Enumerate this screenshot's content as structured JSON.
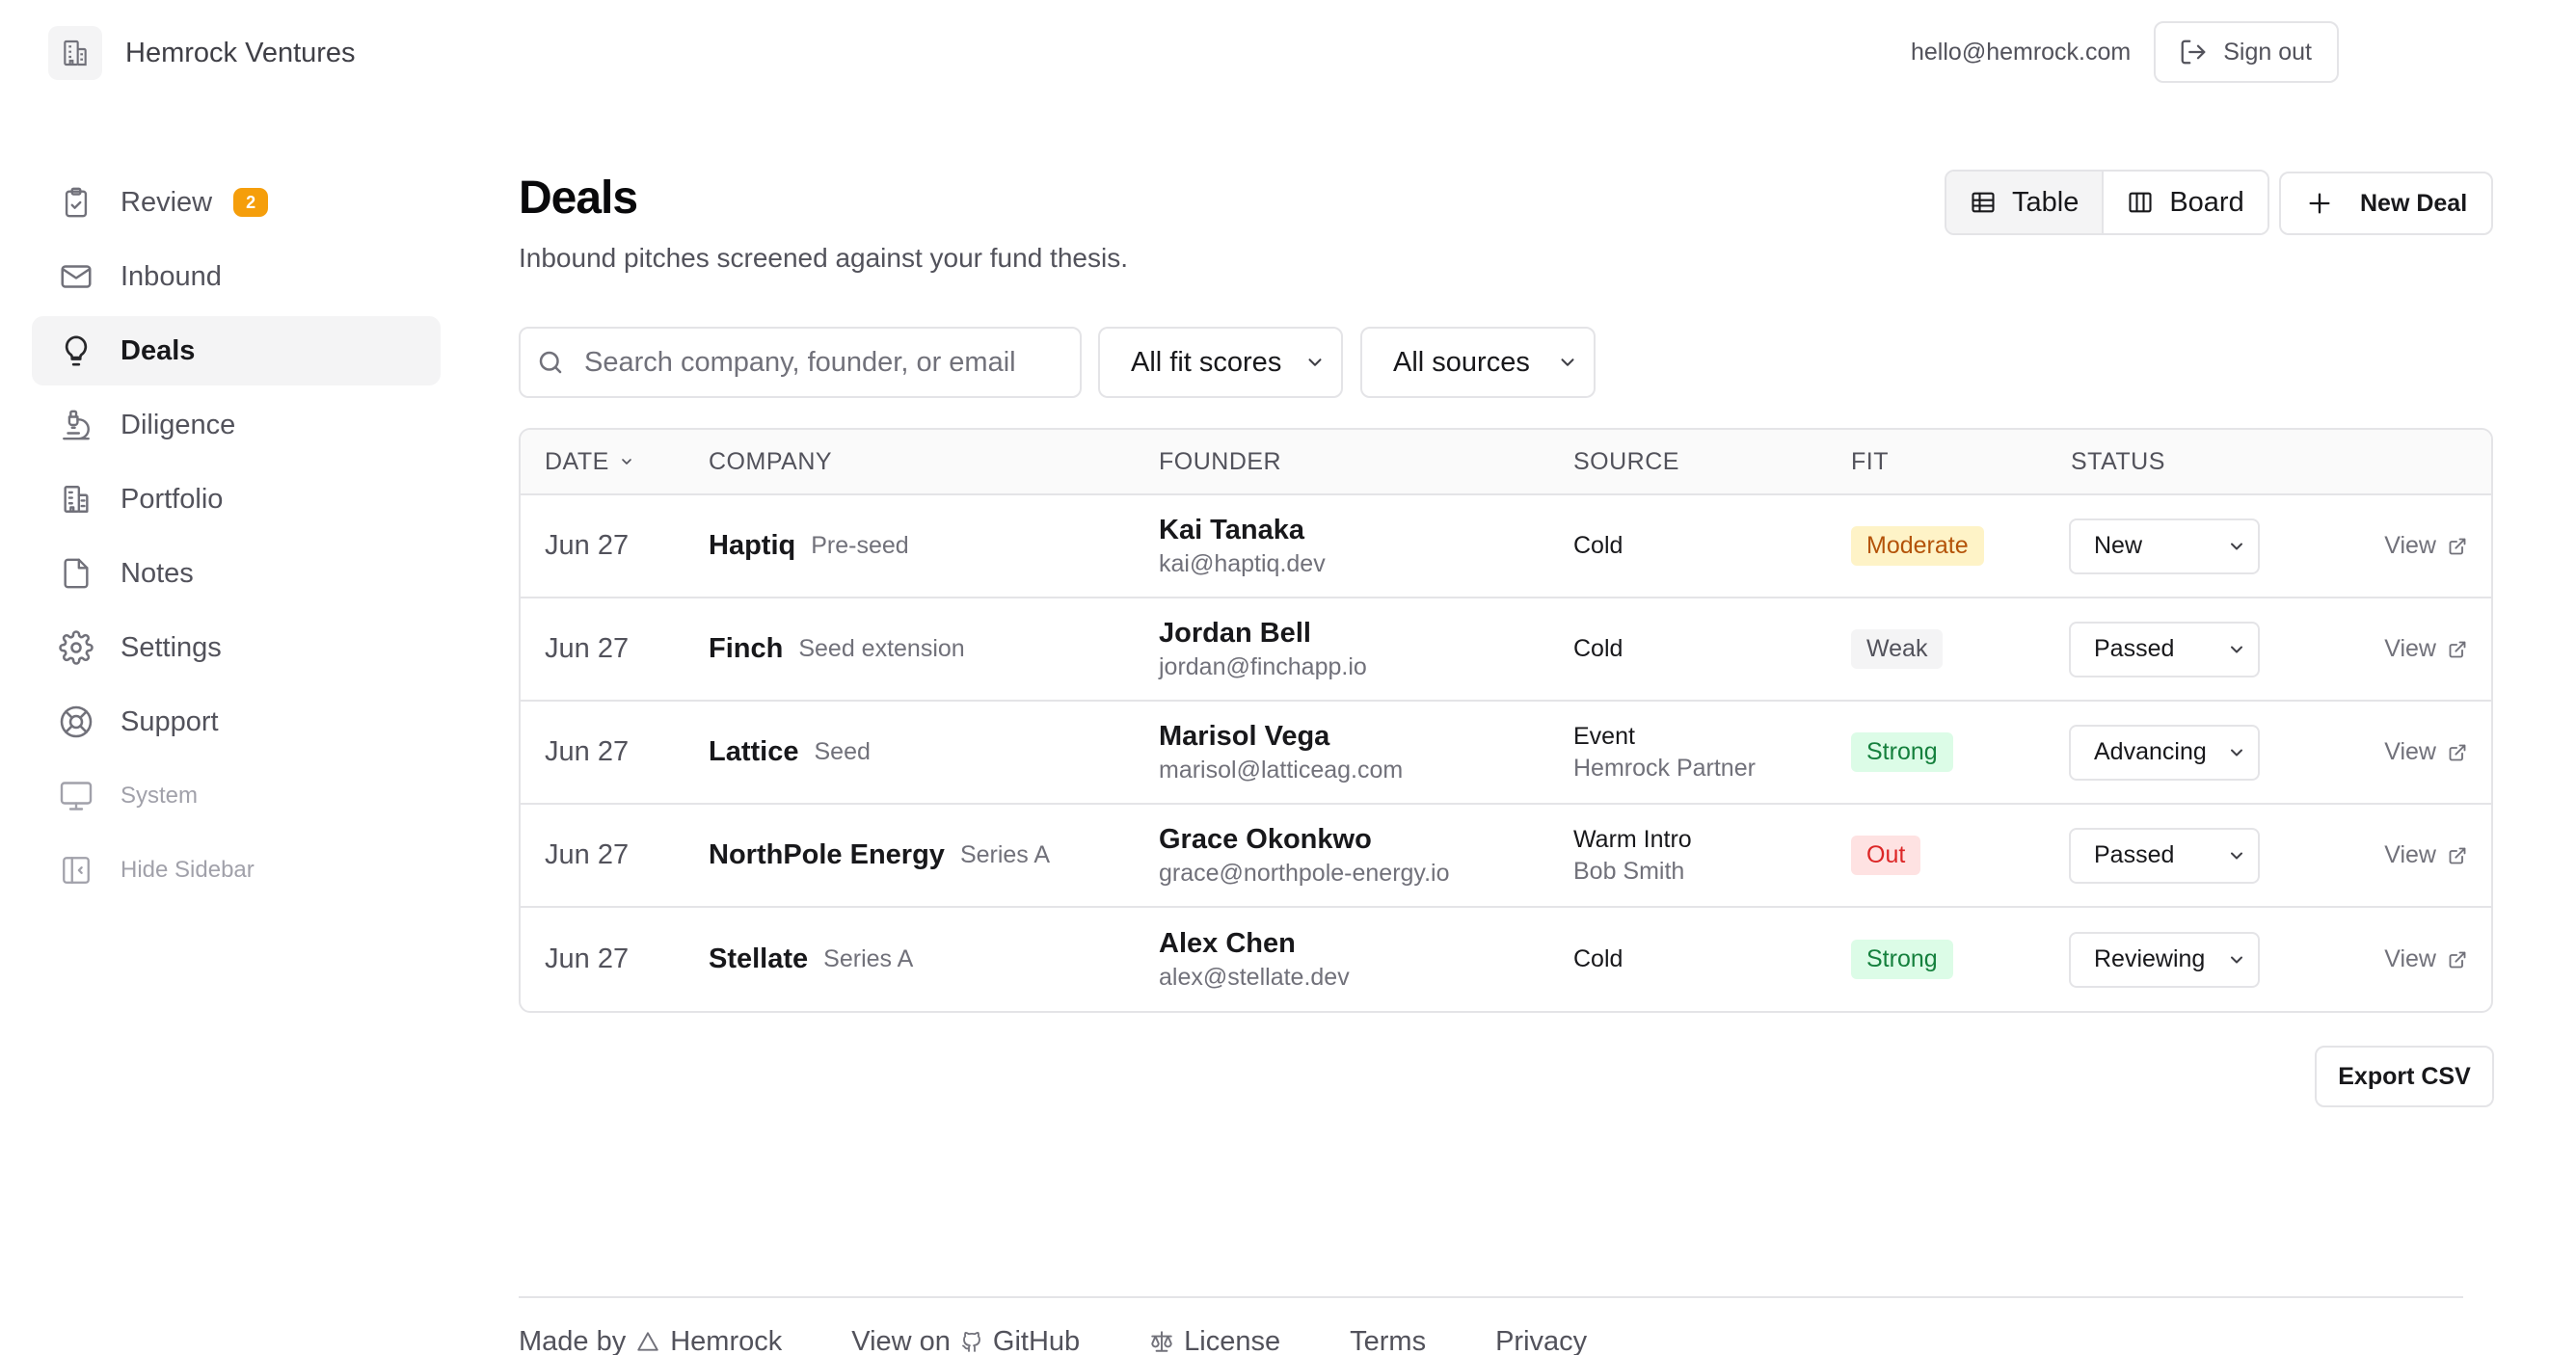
{
  "brand": {
    "name": "Hemrock Ventures",
    "logo_icon": "building-icon"
  },
  "account": {
    "email": "hello@hemrock.com",
    "sign_out_label": "Sign out"
  },
  "sidebar": {
    "items": [
      {
        "label": "Review",
        "icon": "clipboard-check-icon",
        "badge": "2"
      },
      {
        "label": "Inbound",
        "icon": "mail-icon"
      },
      {
        "label": "Deals",
        "icon": "lightbulb-icon",
        "active": true
      },
      {
        "label": "Diligence",
        "icon": "microscope-icon"
      },
      {
        "label": "Portfolio",
        "icon": "building-icon"
      },
      {
        "label": "Notes",
        "icon": "file-icon"
      },
      {
        "label": "Settings",
        "icon": "gear-icon"
      },
      {
        "label": "Support",
        "icon": "lifebuoy-icon"
      },
      {
        "label": "System",
        "icon": "monitor-icon"
      },
      {
        "label": "Hide Sidebar",
        "icon": "panel-left-icon"
      }
    ]
  },
  "page": {
    "title": "Deals",
    "subtitle": "Inbound pitches screened against your fund thesis."
  },
  "toolbar": {
    "table_label": "Table",
    "board_label": "Board",
    "new_deal_label": "New Deal"
  },
  "filters": {
    "search_placeholder": "Search company, founder, or email",
    "fit_selected": "All fit scores",
    "source_selected": "All sources"
  },
  "table": {
    "columns": [
      "DATE",
      "COMPANY",
      "FOUNDER",
      "SOURCE",
      "FIT",
      "STATUS"
    ],
    "rows": [
      {
        "date": "Jun 27",
        "company": "Haptiq",
        "stage": "Pre-seed",
        "founder": "Kai Tanaka",
        "email": "kai@haptiq.dev",
        "source": "Cold",
        "source_detail": "",
        "fit": "Moderate",
        "status": "New",
        "view": "View"
      },
      {
        "date": "Jun 27",
        "company": "Finch",
        "stage": "Seed extension",
        "founder": "Jordan Bell",
        "email": "jordan@finchapp.io",
        "source": "Cold",
        "source_detail": "",
        "fit": "Weak",
        "status": "Passed",
        "view": "View"
      },
      {
        "date": "Jun 27",
        "company": "Lattice",
        "stage": "Seed",
        "founder": "Marisol Vega",
        "email": "marisol@latticeag.com",
        "source": "Event",
        "source_detail": "Hemrock Partner",
        "fit": "Strong",
        "status": "Advancing",
        "view": "View"
      },
      {
        "date": "Jun 27",
        "company": "NorthPole Energy",
        "stage": "Series A",
        "founder": "Grace Okonkwo",
        "email": "grace@northpole-energy.io",
        "source": "Warm Intro",
        "source_detail": "Bob Smith",
        "fit": "Out",
        "status": "Passed",
        "view": "View"
      },
      {
        "date": "Jun 27",
        "company": "Stellate",
        "stage": "Series A",
        "founder": "Alex Chen",
        "email": "alex@stellate.dev",
        "source": "Cold",
        "source_detail": "",
        "fit": "Strong",
        "status": "Reviewing",
        "view": "View"
      }
    ]
  },
  "export_label": "Export CSV",
  "footer": {
    "made_by": "Made by",
    "made_by_name": "Hemrock",
    "view_on": "View on",
    "github": "GitHub",
    "license": "License",
    "terms": "Terms",
    "privacy": "Privacy"
  },
  "colors": {
    "fit_moderate": "#b45309",
    "fit_weak": "#52525b",
    "fit_strong": "#15803d",
    "fit_out": "#dc2626",
    "badge": "#f59e0b"
  }
}
